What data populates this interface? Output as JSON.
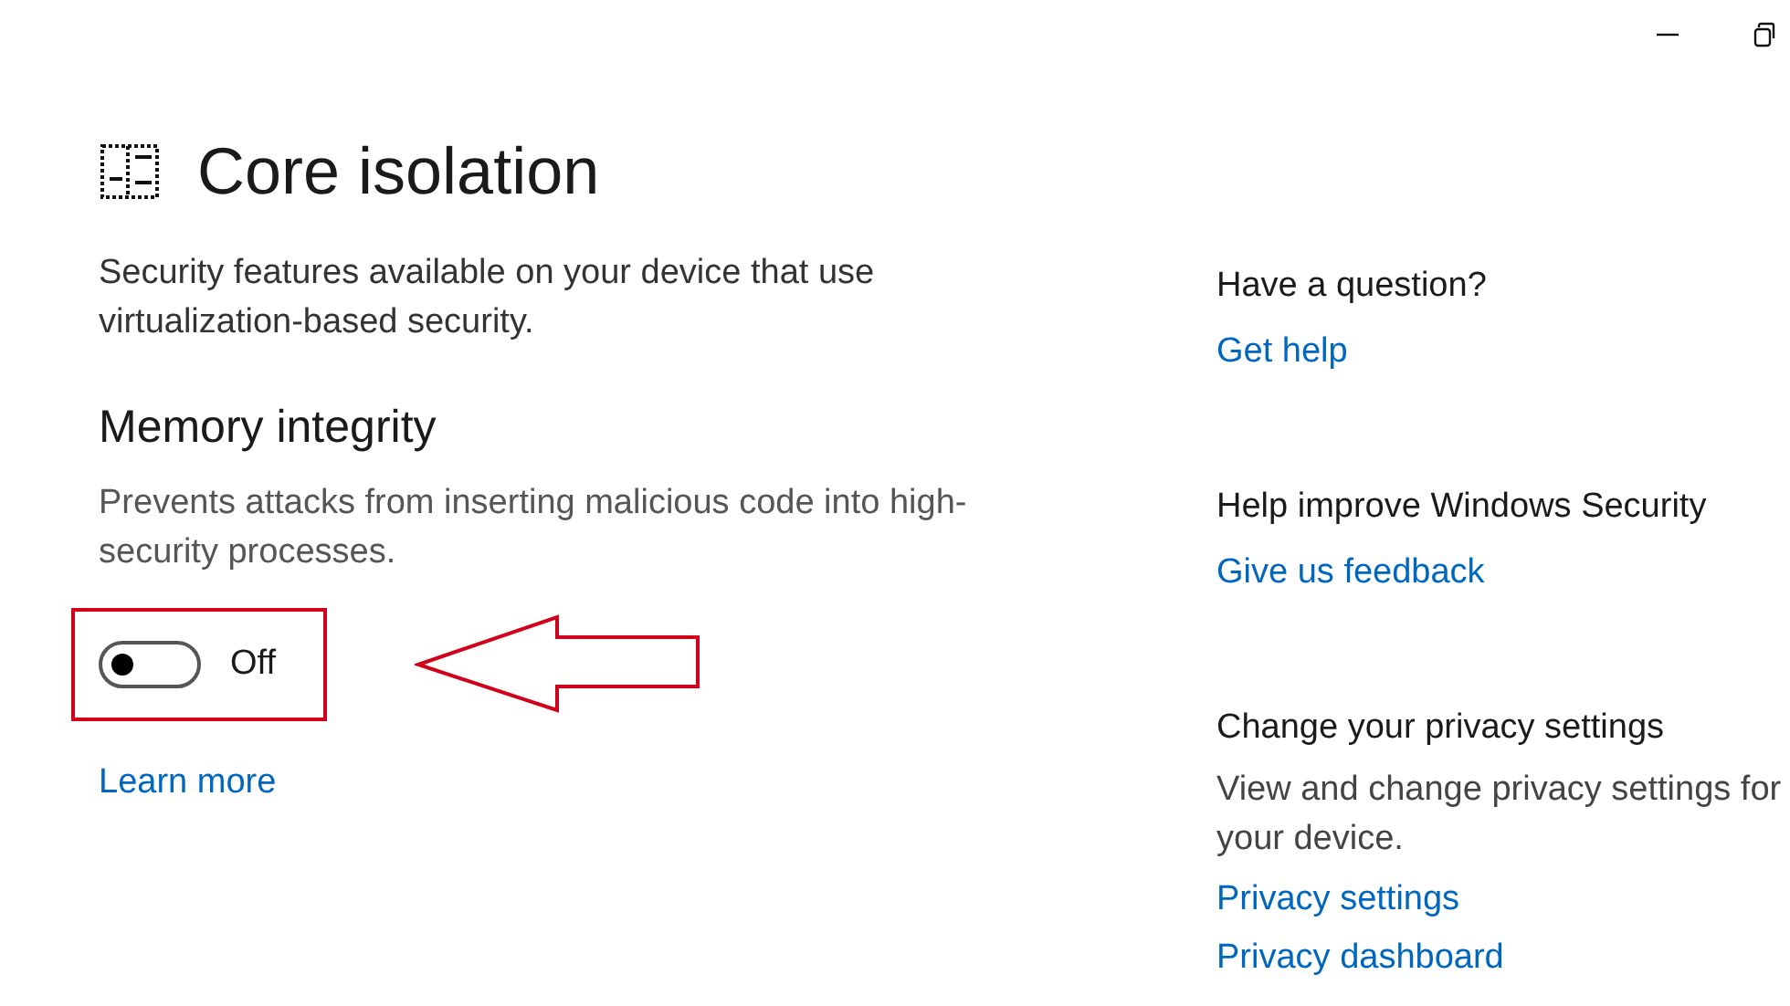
{
  "title": "Core isolation",
  "description": "Security features available on your device that use virtualization-based security.",
  "section": {
    "heading": "Memory integrity",
    "text": "Prevents attacks from inserting malicious code into high-security processes.",
    "toggle": {
      "on": false,
      "label": "Off"
    },
    "link": "Learn more"
  },
  "sidebar": [
    {
      "heading": "Have a question?",
      "links": [
        "Get help"
      ]
    },
    {
      "heading": "Help improve Windows Security",
      "links": [
        "Give us feedback"
      ]
    },
    {
      "heading": "Change your privacy settings",
      "text": "View and change privacy settings for your  device.",
      "links": [
        "Privacy settings",
        "Privacy dashboard"
      ]
    }
  ]
}
